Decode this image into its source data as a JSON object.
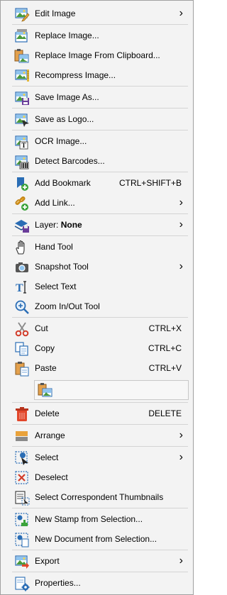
{
  "menu": {
    "items": [
      {
        "name": "edit-image",
        "label": "Edit Image",
        "submenu": true,
        "icon": "edit-image-icon"
      },
      {
        "sep": true
      },
      {
        "name": "replace-image",
        "label": "Replace Image...",
        "icon": "replace-image-icon"
      },
      {
        "name": "replace-image-clipboard",
        "label": "Replace Image From Clipboard...",
        "icon": "replace-clipboard-icon"
      },
      {
        "name": "recompress-image",
        "label": "Recompress Image...",
        "icon": "recompress-image-icon"
      },
      {
        "sep": true
      },
      {
        "name": "save-image-as",
        "label": "Save Image As...",
        "icon": "save-image-icon"
      },
      {
        "sep": true
      },
      {
        "name": "save-as-logo",
        "label": "Save as Logo...",
        "icon": "save-logo-icon"
      },
      {
        "sep": true
      },
      {
        "name": "ocr-image",
        "label": "OCR Image...",
        "icon": "ocr-image-icon"
      },
      {
        "name": "detect-barcodes",
        "label": "Detect Barcodes...",
        "icon": "barcode-icon"
      },
      {
        "sep": true
      },
      {
        "name": "add-bookmark",
        "label": "Add Bookmark",
        "shortcut": "CTRL+SHIFT+B",
        "icon": "bookmark-icon"
      },
      {
        "name": "add-link",
        "label": "Add Link...",
        "submenu": true,
        "icon": "link-icon"
      },
      {
        "sep": true
      },
      {
        "name": "layer",
        "label": "Layer:",
        "bold": "None",
        "submenu": true,
        "icon": "layer-icon"
      },
      {
        "sep": true
      },
      {
        "name": "hand-tool",
        "label": "Hand Tool",
        "icon": "hand-icon"
      },
      {
        "name": "snapshot-tool",
        "label": "Snapshot Tool",
        "submenu": true,
        "icon": "camera-icon"
      },
      {
        "name": "select-text",
        "label": "Select Text",
        "icon": "select-text-icon"
      },
      {
        "name": "zoom-tool",
        "label": "Zoom In/Out Tool",
        "icon": "zoom-icon"
      },
      {
        "sep": true
      },
      {
        "name": "cut",
        "label": "Cut",
        "shortcut": "CTRL+X",
        "icon": "scissors-icon"
      },
      {
        "name": "copy",
        "label": "Copy",
        "shortcut": "CTRL+C",
        "icon": "copy-icon"
      },
      {
        "name": "paste",
        "label": "Paste",
        "shortcut": "CTRL+V",
        "icon": "paste-icon"
      },
      {
        "pastebox": true
      },
      {
        "sep": true
      },
      {
        "name": "delete",
        "label": "Delete",
        "shortcut": "DELETE",
        "icon": "trash-icon"
      },
      {
        "sep": true
      },
      {
        "name": "arrange",
        "label": "Arrange",
        "submenu": true,
        "icon": "arrange-icon"
      },
      {
        "sep": true
      },
      {
        "name": "select",
        "label": "Select",
        "submenu": true,
        "icon": "select-icon"
      },
      {
        "name": "deselect",
        "label": "Deselect",
        "icon": "deselect-icon"
      },
      {
        "name": "select-thumbnails",
        "label": "Select Correspondent Thumbnails",
        "icon": "thumbnails-icon"
      },
      {
        "sep": true
      },
      {
        "name": "new-stamp",
        "label": "New Stamp from Selection...",
        "icon": "stamp-icon"
      },
      {
        "name": "new-document",
        "label": "New Document from Selection...",
        "icon": "new-document-icon"
      },
      {
        "sep": true
      },
      {
        "name": "export",
        "label": "Export",
        "submenu": true,
        "icon": "export-icon"
      },
      {
        "sep": true
      },
      {
        "name": "properties",
        "label": "Properties...",
        "icon": "properties-icon"
      }
    ]
  }
}
